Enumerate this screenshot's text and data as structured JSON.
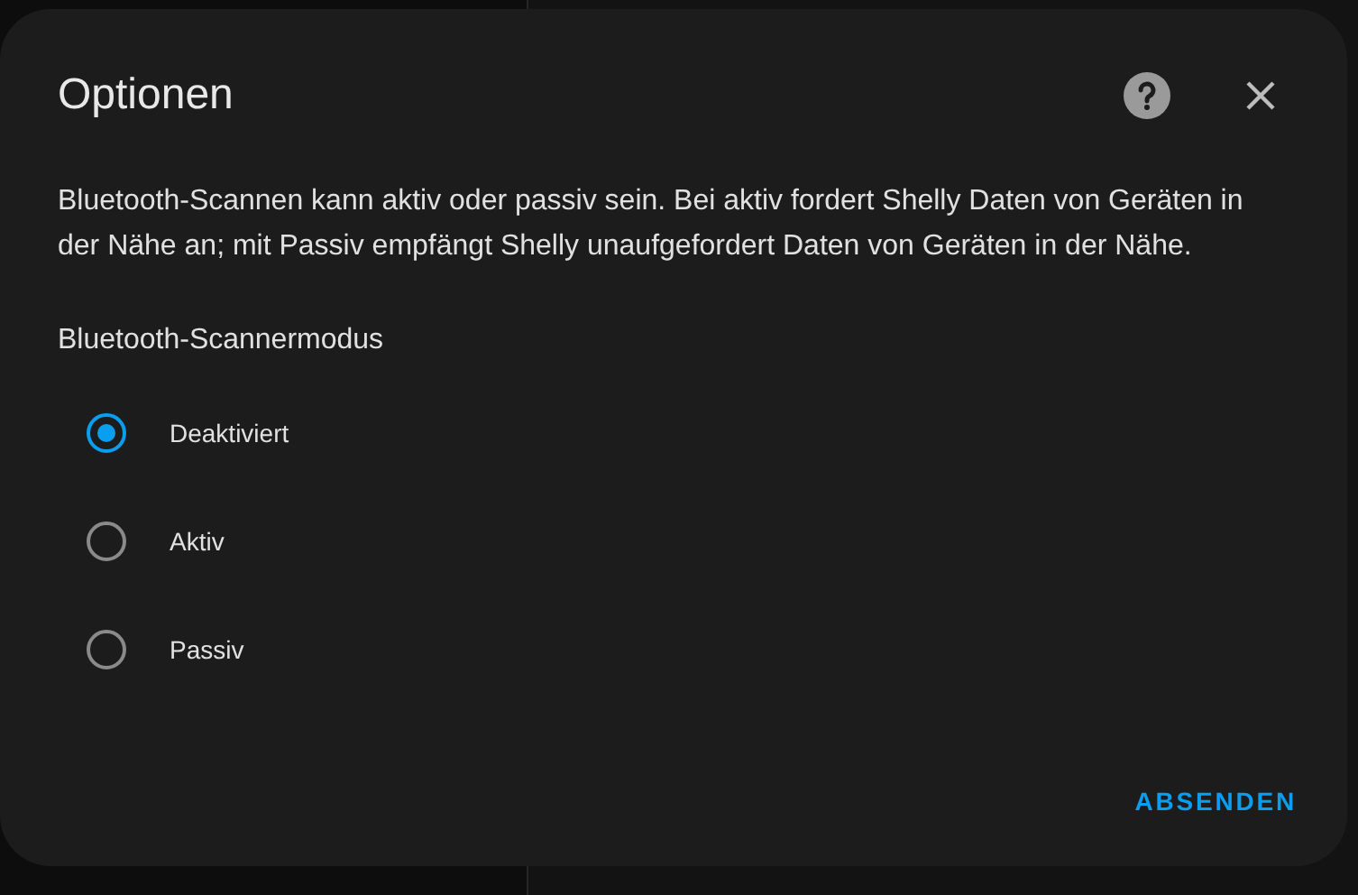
{
  "dialog": {
    "title": "Optionen",
    "description": "Bluetooth-Scannen kann aktiv oder passiv sein. Bei aktiv fordert Shelly Daten von Geräten in der Nähe an; mit Passiv empfängt Shelly unaufgefordert Daten von Geräten in der Nähe.",
    "field_label": "Bluetooth-Scannermodus",
    "options": [
      {
        "label": "Deaktiviert",
        "selected": true
      },
      {
        "label": "Aktiv",
        "selected": false
      },
      {
        "label": "Passiv",
        "selected": false
      }
    ],
    "submit_button": "ABSENDEN"
  }
}
